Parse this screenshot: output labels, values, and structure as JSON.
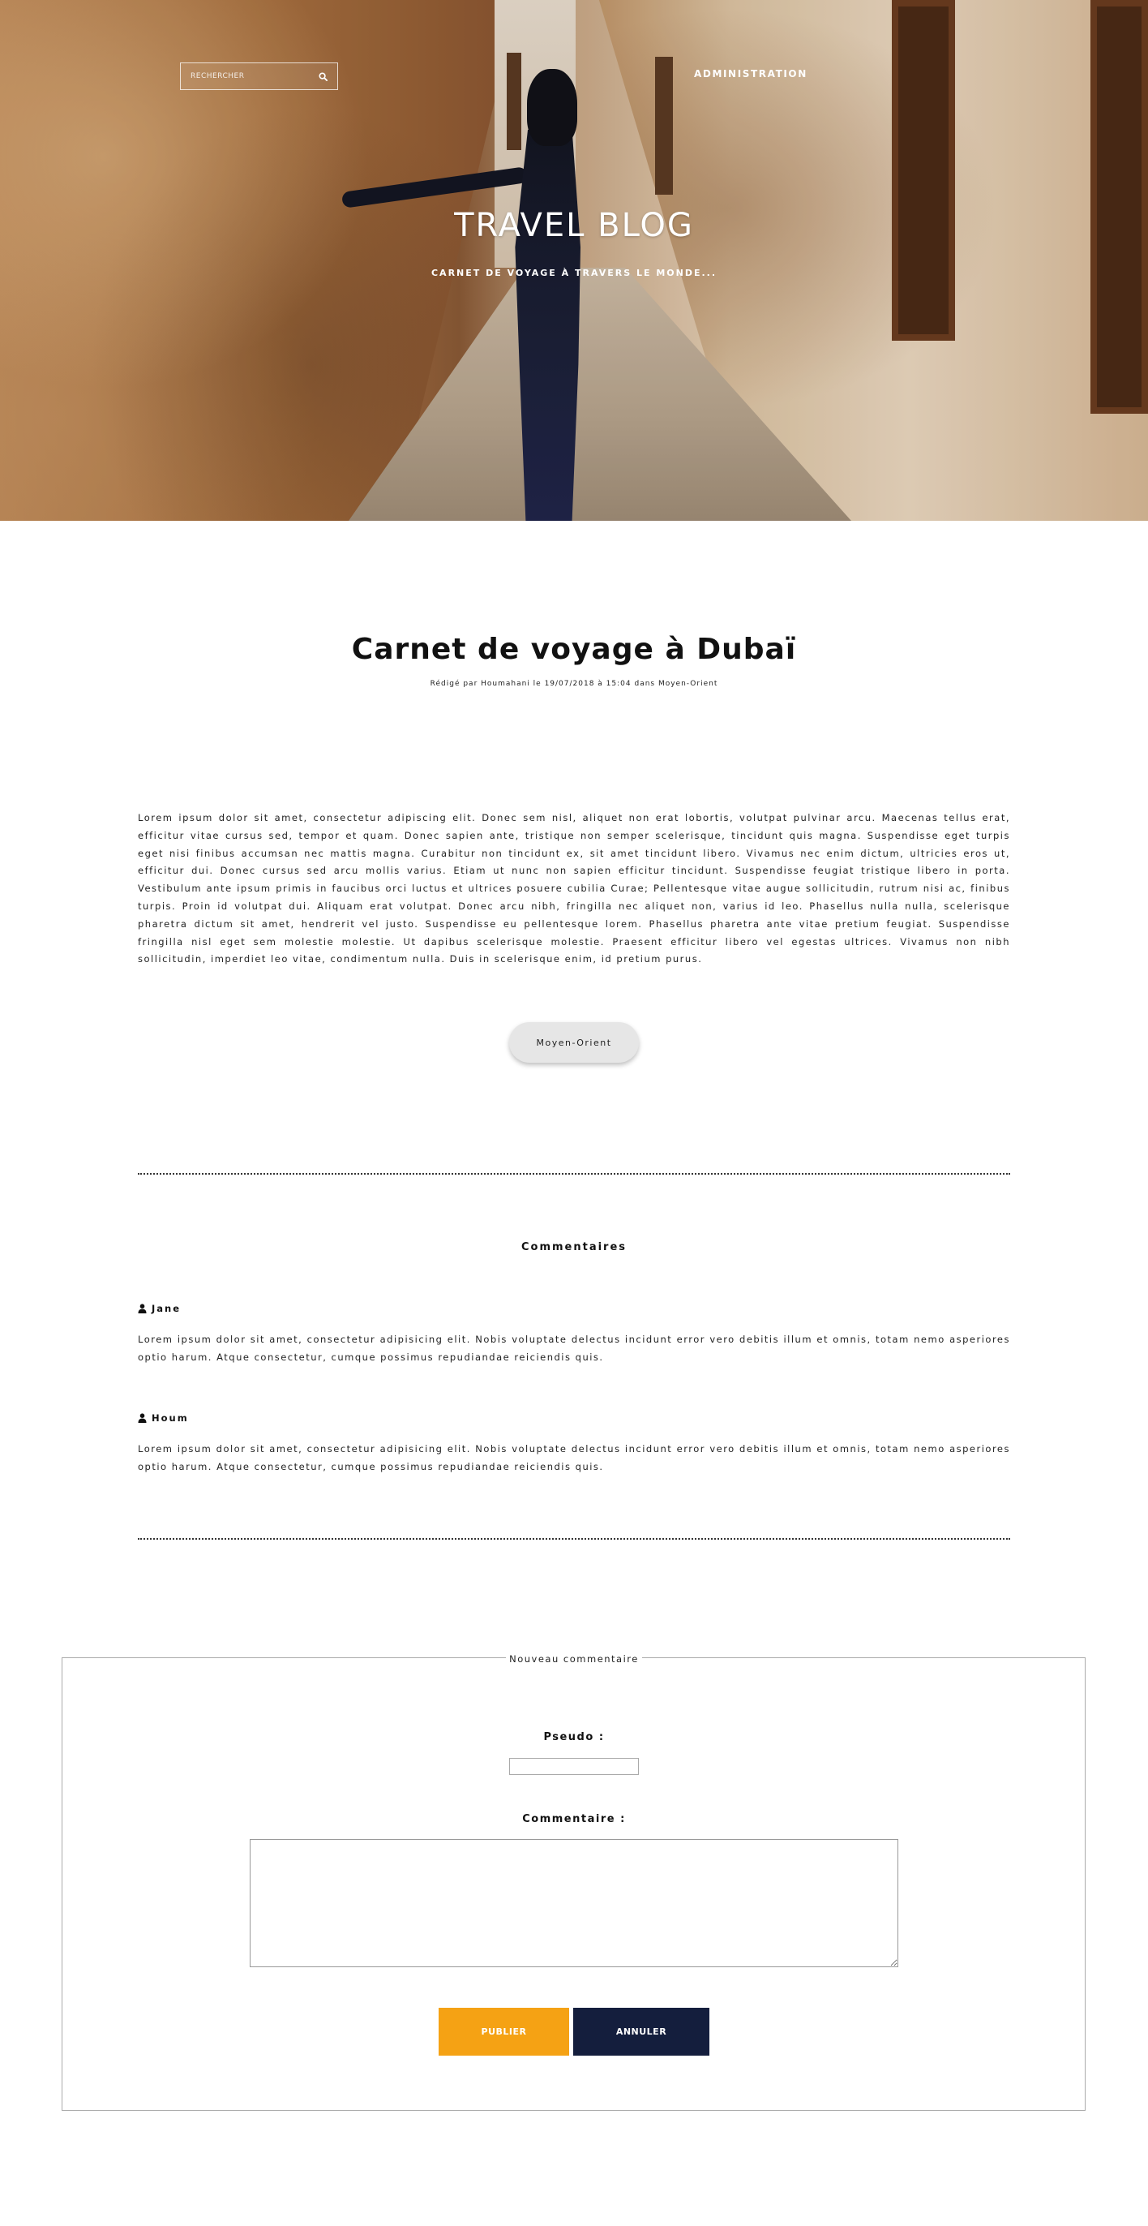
{
  "header": {
    "search": {
      "placeholder": "RECHERCHER"
    },
    "nav": {
      "admin_label": "ADMINISTRATION"
    },
    "blog_title": "TRAVEL BLOG",
    "blog_subtitle": "CARNET DE VOYAGE À TRAVERS LE MONDE..."
  },
  "article": {
    "title": "Carnet de voyage à Dubaï",
    "meta": "Rédigé par Houmahani le 19/07/2018 à 15:04 dans Moyen-Orient",
    "body": "Lorem ipsum dolor sit amet, consectetur adipiscing elit. Donec sem nisl, aliquet non erat lobortis, volutpat pulvinar arcu. Maecenas tellus erat, efficitur vitae cursus sed, tempor et quam. Donec sapien ante, tristique non semper scelerisque, tincidunt quis magna. Suspendisse eget turpis eget nisi finibus accumsan nec mattis magna. Curabitur non tincidunt ex, sit amet tincidunt libero. Vivamus nec enim dictum, ultricies eros ut, efficitur dui. Donec cursus sed arcu mollis varius. Etiam ut nunc non sapien efficitur tincidunt. Suspendisse feugiat tristique libero in porta. Vestibulum ante ipsum primis in faucibus orci luctus et ultrices posuere cubilia Curae; Pellentesque vitae augue sollicitudin, rutrum nisi ac, finibus turpis. Proin id volutpat dui. Aliquam erat volutpat. Donec arcu nibh, fringilla nec aliquet non, varius id leo. Phasellus nulla nulla, scelerisque pharetra dictum sit amet, hendrerit vel justo. Suspendisse eu pellentesque lorem. Phasellus pharetra ante vitae pretium feugiat. Suspendisse fringilla nisl eget sem molestie molestie. Ut dapibus scelerisque molestie. Praesent efficitur libero vel egestas ultrices. Vivamus non nibh sollicitudin, imperdiet leo vitae, condimentum nulla. Duis in scelerisque enim, id pretium purus.",
    "category": "Moyen-Orient"
  },
  "comments": {
    "heading": "Commentaires",
    "items": [
      {
        "author": "Jane",
        "text": "Lorem ipsum dolor sit amet, consectetur adipisicing elit. Nobis voluptate delectus incidunt error vero debitis illum et omnis, totam nemo asperiores optio harum. Atque consectetur, cumque possimus repudiandae reiciendis quis."
      },
      {
        "author": "Houm",
        "text": "Lorem ipsum dolor sit amet, consectetur adipisicing elit. Nobis voluptate delectus incidunt error vero debitis illum et omnis, totam nemo asperiores optio harum. Atque consectetur, cumque possimus repudiandae reiciendis quis."
      }
    ]
  },
  "form": {
    "legend": "Nouveau commentaire",
    "pseudo_label": "Pseudo :",
    "pseudo_value": "",
    "comment_label": "Commentaire :",
    "comment_value": "",
    "publish_label": "PUBLIER",
    "cancel_label": "ANNULER"
  },
  "colors": {
    "publish": "#f5a214",
    "cancel": "#141e3d"
  },
  "icons": {
    "search": "search-icon",
    "user": "user-icon"
  }
}
